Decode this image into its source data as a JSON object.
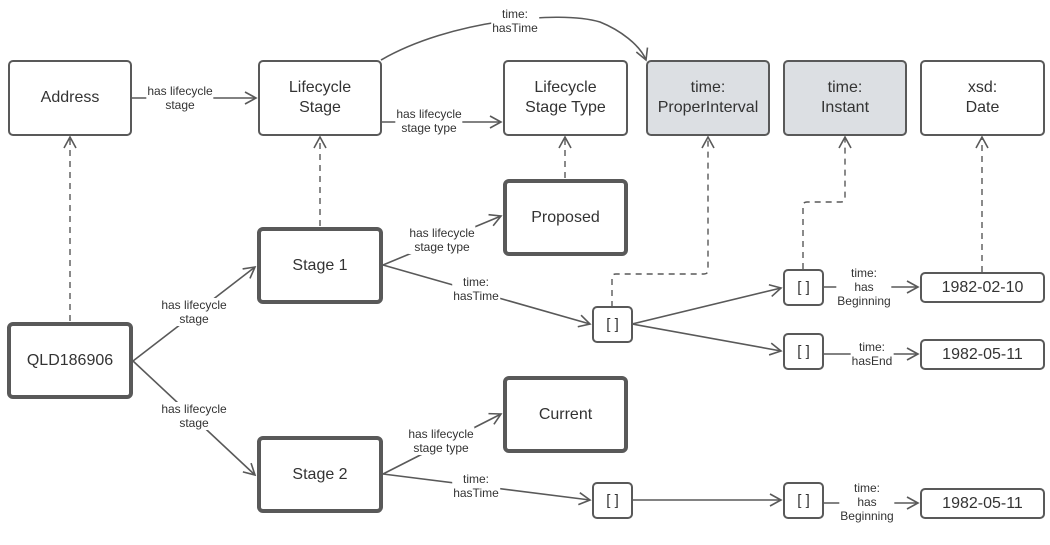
{
  "diagram": {
    "colors": {
      "stroke": "#595959",
      "class_fill_grey": "#dcdfe3",
      "node_fill": "#ffffff",
      "text": "#333333"
    },
    "nodes": {
      "address": "Address",
      "lifecycle_stage": "Lifecycle\nStage",
      "lifecycle_stage_type": "Lifecycle\nStage Type",
      "proper_interval": "time:\nProperInterval",
      "instant": "time:\nInstant",
      "xsd_date": "xsd:\nDate",
      "proposed": "Proposed",
      "stage1": "Stage 1",
      "qld": "QLD186906",
      "current": "Current",
      "stage2": "Stage 2",
      "blank1": "[ ]",
      "blank2": "[ ]",
      "blank3": "[ ]",
      "blank4": "[ ]",
      "blank5": "[ ]",
      "date1": "1982-02-10",
      "date2": "1982-05-11",
      "date3": "1982-05-11"
    },
    "edges": {
      "address_stage": "has lifecycle\nstage",
      "stage_type": "has lifecycle\nstage type",
      "stage_hastime": "time:\nhasTime",
      "qld_stage1": "has lifecycle\nstage",
      "qld_stage2": "has lifecycle\nstage",
      "stage1_type": "has lifecycle\nstage type",
      "stage1_time": "time:\nhasTime",
      "stage2_type": "has lifecycle\nstage type",
      "stage2_time": "time:\nhasTime",
      "b2_begin": "time:\nhas\nBeginning",
      "b3_end": "time:\nhasEnd",
      "b5_begin": "time:\nhas\nBeginning"
    }
  }
}
